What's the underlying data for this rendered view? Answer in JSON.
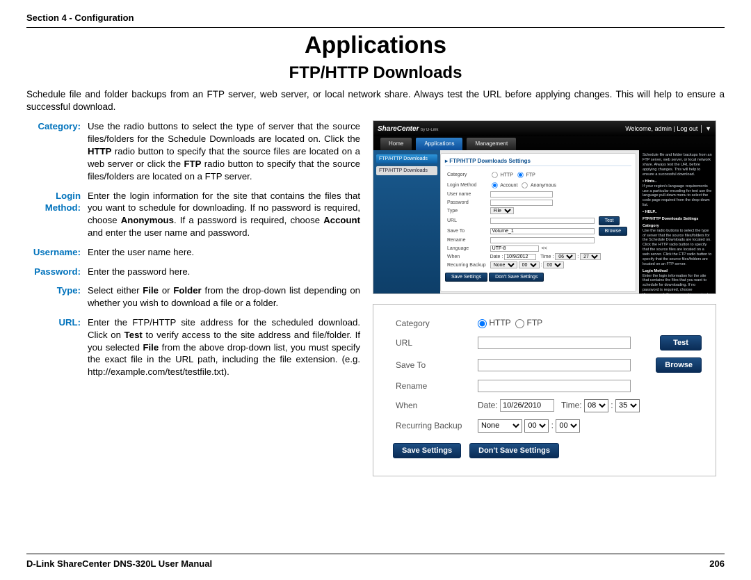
{
  "header": {
    "section": "Section 4 - Configuration"
  },
  "title": "Applications",
  "subtitle": "FTP/HTTP Downloads",
  "intro": "Schedule file and folder backups from an FTP server, web server, or local network share. Always test the URL before applying changes. This will help to ensure a successful download.",
  "defs": {
    "category_term": "Category:",
    "category_desc_a": "Use the radio buttons to select the type of server that the source files/folders for the Schedule Downloads are located on. Click the ",
    "category_desc_b": "HTTP",
    "category_desc_c": " radio button to specify that the source files are located on a web server or click the ",
    "category_desc_d": "FTP",
    "category_desc_e": " radio button to specify that the source files/folders are located on a FTP server.",
    "login_term": "Login Method:",
    "login_desc_a": "Enter the login information for the site that contains the files that you want to schedule for downloading. If no password is required, choose ",
    "login_desc_b": "Anonymous",
    "login_desc_c": ". If a password is required, choose ",
    "login_desc_d": "Account",
    "login_desc_e": " and enter the user name and password.",
    "username_term": "Username:",
    "username_desc": "Enter the user name here.",
    "password_term": "Password:",
    "password_desc": "Enter the password here.",
    "type_term": "Type:",
    "type_desc_a": "Select either ",
    "type_desc_b": "File",
    "type_desc_c": " or ",
    "type_desc_d": "Folder",
    "type_desc_e": " from the drop-down list depending on whether you wish to download a file or a folder.",
    "url_term": "URL:",
    "url_desc_a": "Enter the FTP/HTTP site address for the scheduled download. Click on ",
    "url_desc_b": "Test",
    "url_desc_c": " to verify access to the site address and file/folder. If you selected ",
    "url_desc_d": "File",
    "url_desc_e": " from the above drop-down list, you must specify the exact file in the URL path, including the file extension. (e.g. http://example.com/test/testfile.txt)."
  },
  "app": {
    "brand": "ShareCenter",
    "brand_suffix": "by D-Link",
    "welcome": "Welcome, admin | ",
    "logout": "Log out",
    "tabs": {
      "home": "Home",
      "applications": "Applications",
      "management": "Management"
    },
    "crumb": "FTP/HTTP Downloads",
    "side_item": "FTP/HTTP Downloads",
    "form_title": "FTP/HTTP Downloads Settings",
    "rows": {
      "category": "Category",
      "http": "HTTP",
      "ftp": "FTP",
      "login_method": "Login Method",
      "account": "Account",
      "anonymous": "Anonymous",
      "username": "User name",
      "password": "Password",
      "type": "Type",
      "type_val": "File",
      "url": "URL",
      "save_to": "Save To",
      "save_to_val": "Volume_1",
      "rename": "Rename",
      "language": "Language",
      "language_val": "UTF-8",
      "language_arrows": "<<",
      "when": "When",
      "when_date_lbl": "Date :",
      "when_date": "10/9/2012",
      "when_time_lbl": "Time :",
      "when_hh": "06",
      "when_mm": "27",
      "recurring": "Recurring Backup",
      "recurring_val": "None",
      "rec_hh": "00",
      "rec_mm": "00",
      "test": "Test",
      "browse": "Browse",
      "save": "Save Settings",
      "dont": "Don't Save Settings"
    },
    "help": {
      "intro": "Schedule file and folder backups from an FTP server, web server, or local network share. Always test the URL before applying changes. This will help to ensure a successful download.",
      "hints_h": "Hints..",
      "hints_t": "If your region's language requirements use a particular encoding for text use the language pull-down menu to select the code page required from the drop-down list.",
      "help_h": "HELP..",
      "help_s": "FTP/HTTP Downloads Settings",
      "cat_h": "Category",
      "cat_t": "Use the radio buttons to select the type of server that the source files/folders for the Schedule Downloads are located on. Click the HTTP radio button to specify that the source files are located on a web server. Click the FTP radio button to specify that the source files/folders are located on an FTP server.",
      "lm_h": "Login Method",
      "lm_t": "Enter the login information for the site that contains the files that you want to schedule for downloading. If no password is required, choose 'Anonymous'. If a password is required, choose 'Account' and provide the user name and password."
    }
  },
  "panel": {
    "category": "Category",
    "http": "HTTP",
    "ftp": "FTP",
    "url": "URL",
    "save_to": "Save To",
    "rename": "Rename",
    "when": "When",
    "when_date_lbl": "Date:",
    "when_date": "10/26/2010",
    "when_time_lbl": "Time:",
    "when_hh": "08",
    "when_mm": "35",
    "recurring": "Recurring Backup",
    "recurring_val": "None",
    "rec_hh": "00",
    "rec_mm": "00",
    "test": "Test",
    "browse": "Browse",
    "save": "Save Settings",
    "dont": "Don't Save Settings"
  },
  "footer": {
    "left": "D-Link ShareCenter DNS-320L User Manual",
    "right": "206"
  }
}
